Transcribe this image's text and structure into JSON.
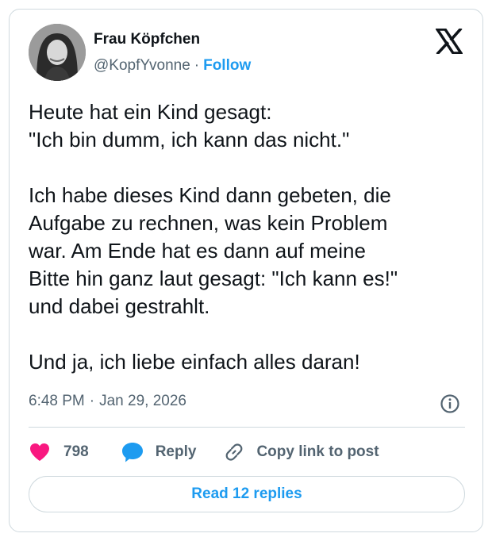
{
  "author": {
    "name": "Frau Köpfchen",
    "handle": "@KopfYvonne",
    "separator": "·",
    "follow_label": "Follow"
  },
  "icons": {
    "brand": "x-logo-icon",
    "info": "info-icon",
    "like": "heart-icon",
    "reply": "speech-bubble-icon",
    "copy": "link-icon"
  },
  "colors": {
    "accent": "#1d9bf0",
    "like": "#f91880",
    "secondary_text": "#536471",
    "border": "#cfd9de"
  },
  "tweet": {
    "lines": [
      "Heute hat ein Kind gesagt:",
      "\"Ich bin dumm, ich kann das nicht.\"",
      "",
      "Ich habe dieses Kind dann gebeten, die",
      "Aufgabe zu rechnen, was kein Problem",
      "war. Am Ende hat es dann auf meine",
      "Bitte hin ganz laut gesagt: \"Ich kann es!\"",
      "und dabei gestrahlt.",
      "",
      "Und ja, ich liebe einfach alles daran!"
    ],
    "time": "6:48 PM",
    "separator": "·",
    "date": "Jan 29, 2026"
  },
  "actions": {
    "like_count": "798",
    "reply_label": "Reply",
    "copy_label": "Copy link to post"
  },
  "footer": {
    "read_replies_label": "Read 12 replies"
  }
}
